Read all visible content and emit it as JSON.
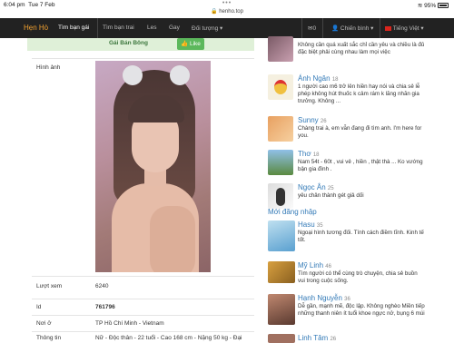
{
  "status": {
    "time": "6:04 pm",
    "date": "Tue 7 Feb",
    "url": "henho.top",
    "dots": "•••",
    "battery": "95%"
  },
  "nav": {
    "brand": "Hẹn Hò",
    "items": [
      "Tìm bạn gái",
      "Tìm bạn trai",
      "Les",
      "Gay",
      "Đối tượng ▾"
    ],
    "mail_count": "0",
    "user": "Chiến bình ▾",
    "lang": "Tiếng Việt ▾"
  },
  "profile": {
    "name_link": "Gái Bán Bông",
    "like_label": "Like",
    "photo_label": "Hình ảnh",
    "rows": [
      {
        "label": "Lượt xem",
        "value": "6240"
      },
      {
        "label": "Id",
        "value": "761796"
      },
      {
        "label": "Nơi ở",
        "value": "TP Hồ Chí Minh - Vietnam"
      },
      {
        "label": "Thông tin",
        "value": "Nữ - Độc thân - 22 tuổi - Cao 168 cm - Nặng 50 kg - Đại"
      }
    ]
  },
  "sidebar": {
    "top_entries": [
      {
        "name": "",
        "age": "",
        "text": "Không cần quá xuất sắc chỉ cần yêu và chiều là đủ đặc biệt phải cùng nhau làm mọi việc"
      },
      {
        "name": "Ánh Ngân",
        "age": "18",
        "text": "1 người cao m6 trở lên hiền hay nói và chia sẻ lễ phép không hút thuốc k cảm rám k lăng nhăn gia trưởng. Không ..."
      },
      {
        "name": "Sunny",
        "age": "26",
        "text": "Chàng trai à, em vẫn đang đi tìm anh. I'm here for you."
      },
      {
        "name": "Thơ",
        "age": "18",
        "text": "Nam 54t - 60t , vui vẻ , hiền , thật thà ... Ko vướng bận gia đình ."
      },
      {
        "name": "Ngọc Ân",
        "age": "25",
        "text": "yêu chân thành gét giả dối"
      }
    ],
    "new_heading": "Mới đăng nhập",
    "new_entries": [
      {
        "name": "Hasu",
        "age": "35",
        "text": "Ngoại hình tương đối. Tính cách điềm tĩnh. Kinh tế tốt."
      },
      {
        "name": "Mỹ Linh",
        "age": "46",
        "text": "Tìm người có thể cùng trò chuyện, chia sẻ buồn vui trong cuộc sống."
      },
      {
        "name": "Hạnh Nguyễn",
        "age": "36",
        "text": "Dễ gần, mạnh mẽ, độc lập. Không nghèo Miền tiếp những thanh niên ít tuổi khoe ngực nở, bụng 6 múi"
      },
      {
        "name": "Linh Tâm",
        "age": "26",
        "text": ""
      }
    ]
  }
}
